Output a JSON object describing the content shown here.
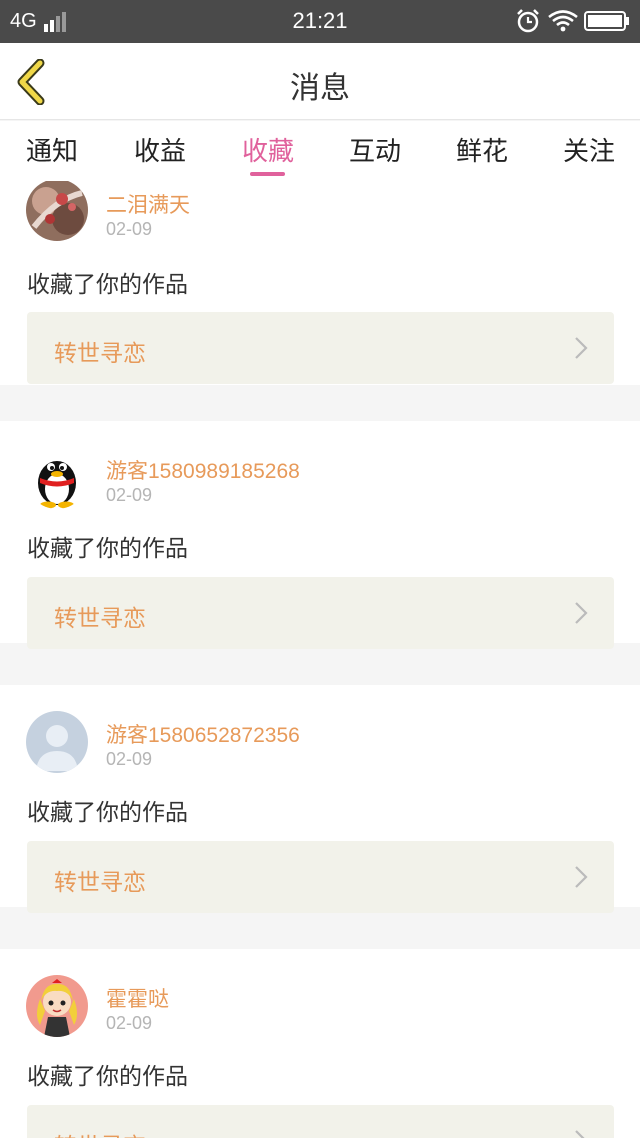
{
  "status_bar": {
    "network": "4G",
    "time": "21:21"
  },
  "header": {
    "title": "消息"
  },
  "tabs": [
    {
      "label": "通知"
    },
    {
      "label": "收益"
    },
    {
      "label": "收藏",
      "active": true
    },
    {
      "label": "互动"
    },
    {
      "label": "鲜花"
    },
    {
      "label": "关注"
    }
  ],
  "colors": {
    "accent": "#e0619c",
    "username": "#e79a5a",
    "work_card_bg": "#f2f2ea"
  },
  "feed": [
    {
      "username": "二泪满天",
      "date": "02-09",
      "action": "收藏了你的作品",
      "work_title": "转世寻恋",
      "avatar_icon": "photo-avatar"
    },
    {
      "username": "游客1580989185268",
      "date": "02-09",
      "action": "收藏了你的作品",
      "work_title": "转世寻恋",
      "avatar_icon": "qq-penguin-avatar"
    },
    {
      "username": "游客1580652872356",
      "date": "02-09",
      "action": "收藏了你的作品",
      "work_title": "转世寻恋",
      "avatar_icon": "default-person-avatar"
    },
    {
      "username": "霍霍哒",
      "date": "02-09",
      "action": "收藏了你的作品",
      "work_title": "转世寻恋",
      "avatar_icon": "cartoon-girl-avatar"
    }
  ]
}
